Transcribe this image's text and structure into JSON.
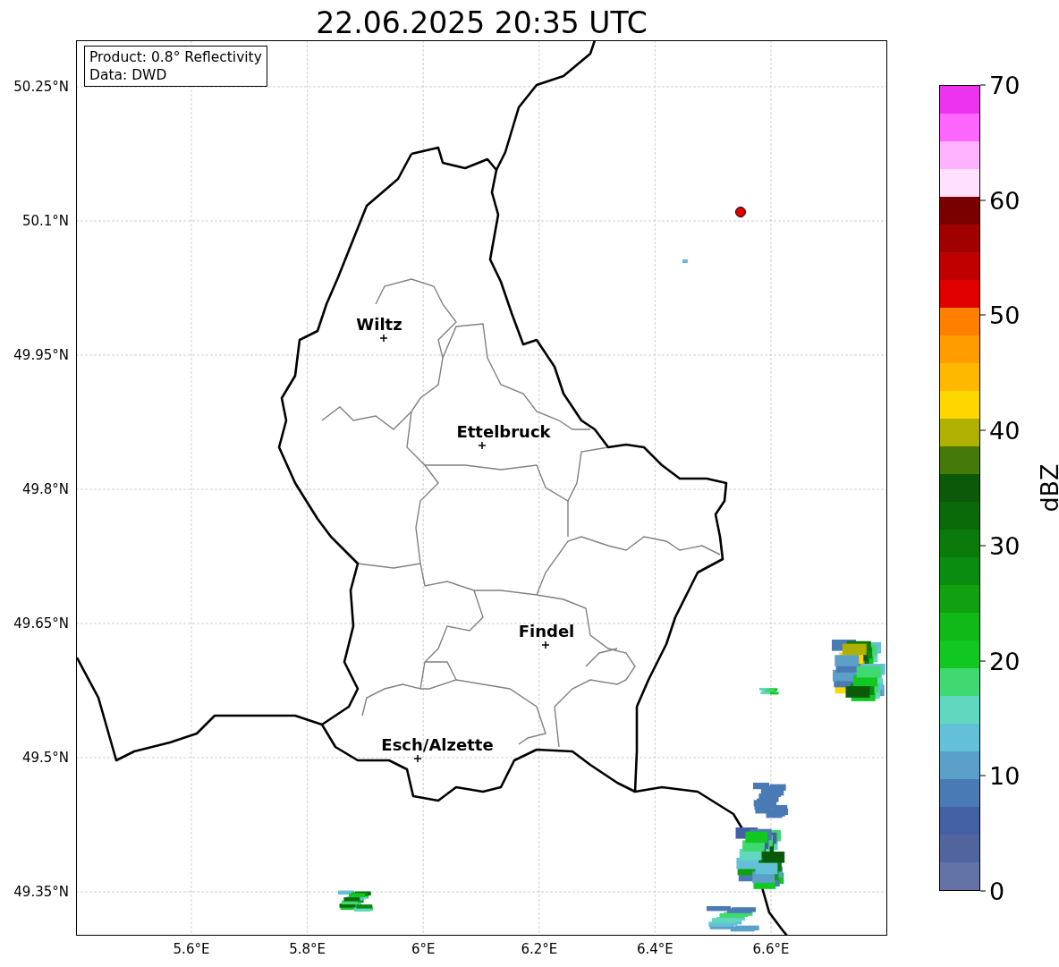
{
  "title": "22.06.2025 20:35 UTC",
  "info_box": {
    "lines": [
      "Product: 0.8° Reflectivity",
      "Data: DWD"
    ]
  },
  "map": {
    "lat_ticks": [
      "50.25°N",
      "50.1°N",
      "49.95°N",
      "49.8°N",
      "49.65°N",
      "49.5°N",
      "49.35°N"
    ],
    "lon_ticks": [
      "5.6°E",
      "5.8°E",
      "6°E",
      "6.2°E",
      "6.4°E",
      "6.6°E"
    ],
    "cities": [
      {
        "name": "Wiltz"
      },
      {
        "name": "Ettelbruck"
      },
      {
        "name": "Findel"
      },
      {
        "name": "Esch/Alzette"
      }
    ],
    "radar_marker": {
      "color": "#e00000"
    }
  },
  "colorbar": {
    "label": "dBZ",
    "ticks": [
      "70",
      "60",
      "50",
      "40",
      "30",
      "20",
      "10",
      "0"
    ],
    "bins": [
      {
        "color": "#ee33ee"
      },
      {
        "color": "#ff66ff"
      },
      {
        "color": "#ffb3ff"
      },
      {
        "color": "#ffe0ff"
      },
      {
        "color": "#7a0000"
      },
      {
        "color": "#a00000"
      },
      {
        "color": "#c00000"
      },
      {
        "color": "#e00000"
      },
      {
        "color": "#ff7f00"
      },
      {
        "color": "#ff9c00"
      },
      {
        "color": "#ffb800"
      },
      {
        "color": "#ffd700"
      },
      {
        "color": "#b0b000"
      },
      {
        "color": "#457a0a"
      },
      {
        "color": "#0a5a0a"
      },
      {
        "color": "#0a6a0a"
      },
      {
        "color": "#0a7a0a"
      },
      {
        "color": "#0a8c10"
      },
      {
        "color": "#10a010"
      },
      {
        "color": "#10b818"
      },
      {
        "color": "#10c820"
      },
      {
        "color": "#40d870"
      },
      {
        "color": "#60d8c0"
      },
      {
        "color": "#64c0d8"
      },
      {
        "color": "#5aa0c8"
      },
      {
        "color": "#4a7ab4"
      },
      {
        "color": "#4460a4"
      },
      {
        "color": "#52649e"
      },
      {
        "color": "#6272a4"
      }
    ]
  }
}
